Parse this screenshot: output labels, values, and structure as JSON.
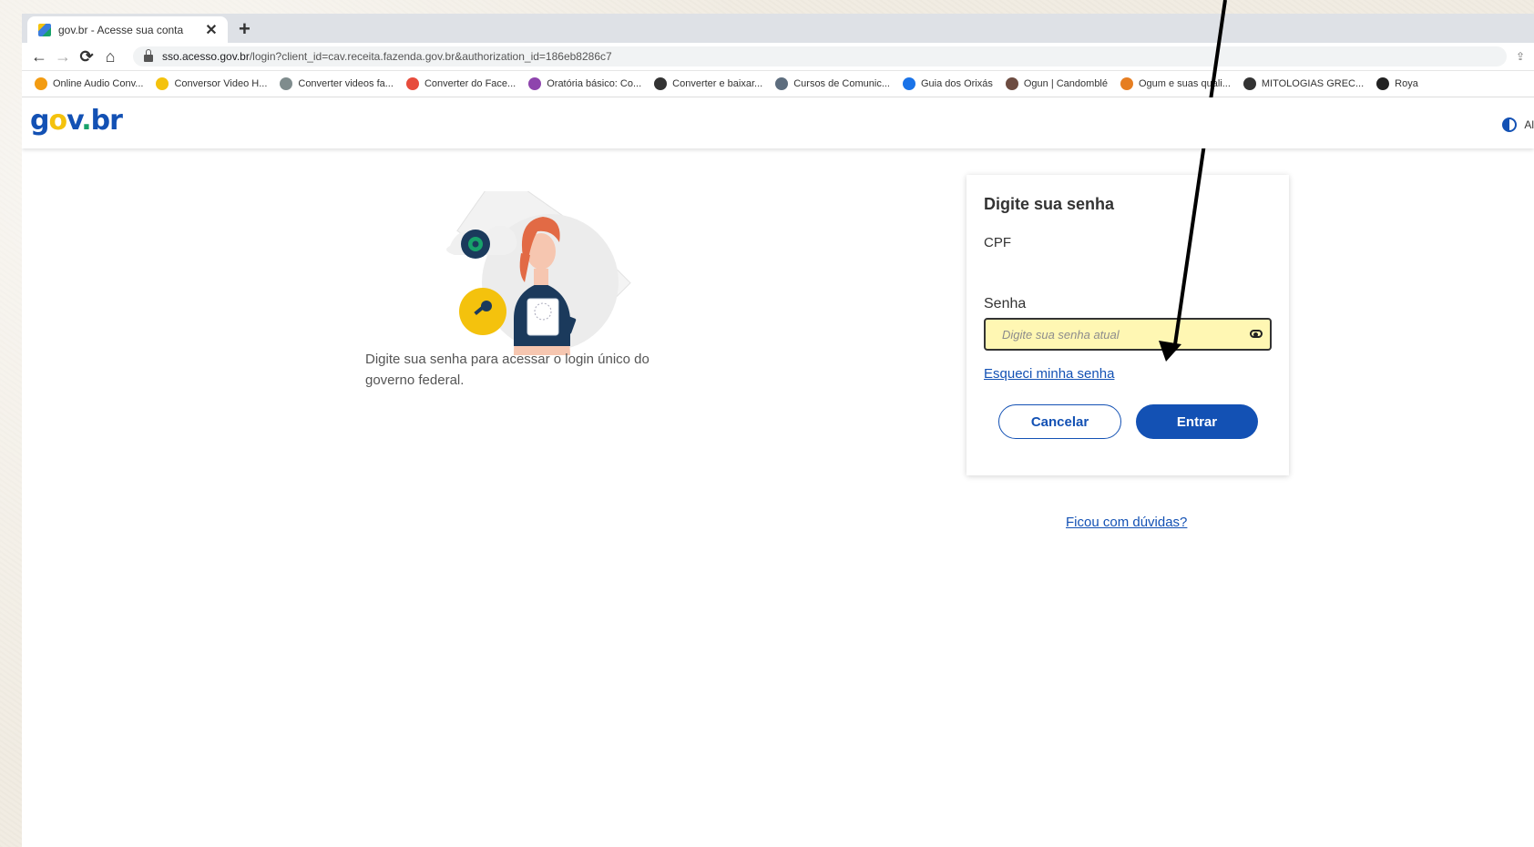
{
  "browser": {
    "tab_title": "gov.br - Acesse sua conta",
    "tab_close": "✕",
    "new_tab": "+",
    "url_host": "sso.acesso.gov.br",
    "url_path": "/login?client_id=cav.receita.fazenda.gov.br&authorization_id=186eb8286c7",
    "bookmarks": [
      {
        "label": "Online Audio Conv...",
        "color": "#f39c12"
      },
      {
        "label": "Conversor Video H...",
        "color": "#f4c20d"
      },
      {
        "label": "Converter videos fa...",
        "color": "#7f8c8d"
      },
      {
        "label": "Converter  do Face...",
        "color": "#e74c3c"
      },
      {
        "label": "Oratória básico: Co...",
        "color": "#8e44ad"
      },
      {
        "label": "Converter e baixar...",
        "color": "#333333"
      },
      {
        "label": "Cursos de Comunic...",
        "color": "#5d6d7e"
      },
      {
        "label": "Guia dos Orixás",
        "color": "#1a73e8"
      },
      {
        "label": "Ogun | Candomblé",
        "color": "#6d4c41"
      },
      {
        "label": "Ogum e suas quali...",
        "color": "#e67e22"
      },
      {
        "label": "MITOLOGIAS GREC...",
        "color": "#333333"
      },
      {
        "label": "Roya",
        "color": "#222222"
      }
    ]
  },
  "header": {
    "logo": {
      "g": "g",
      "o": "o",
      "v": "v",
      "dot": ".",
      "b": "b",
      "r": "r"
    },
    "contrast_label": "Al"
  },
  "main": {
    "description": "Digite sua senha para acessar o login único do governo federal."
  },
  "login_card": {
    "title": "Digite sua senha",
    "cpf_label": "CPF",
    "password_label": "Senha",
    "password_placeholder": "Digite sua senha atual",
    "forgot_link": "Esqueci minha senha",
    "cancel_button": "Cancelar",
    "enter_button": "Entrar"
  },
  "help_link": "Ficou com dúvidas?",
  "colors": {
    "brand_blue": "#1351b4",
    "highlight_yellow": "#fff7b3"
  }
}
